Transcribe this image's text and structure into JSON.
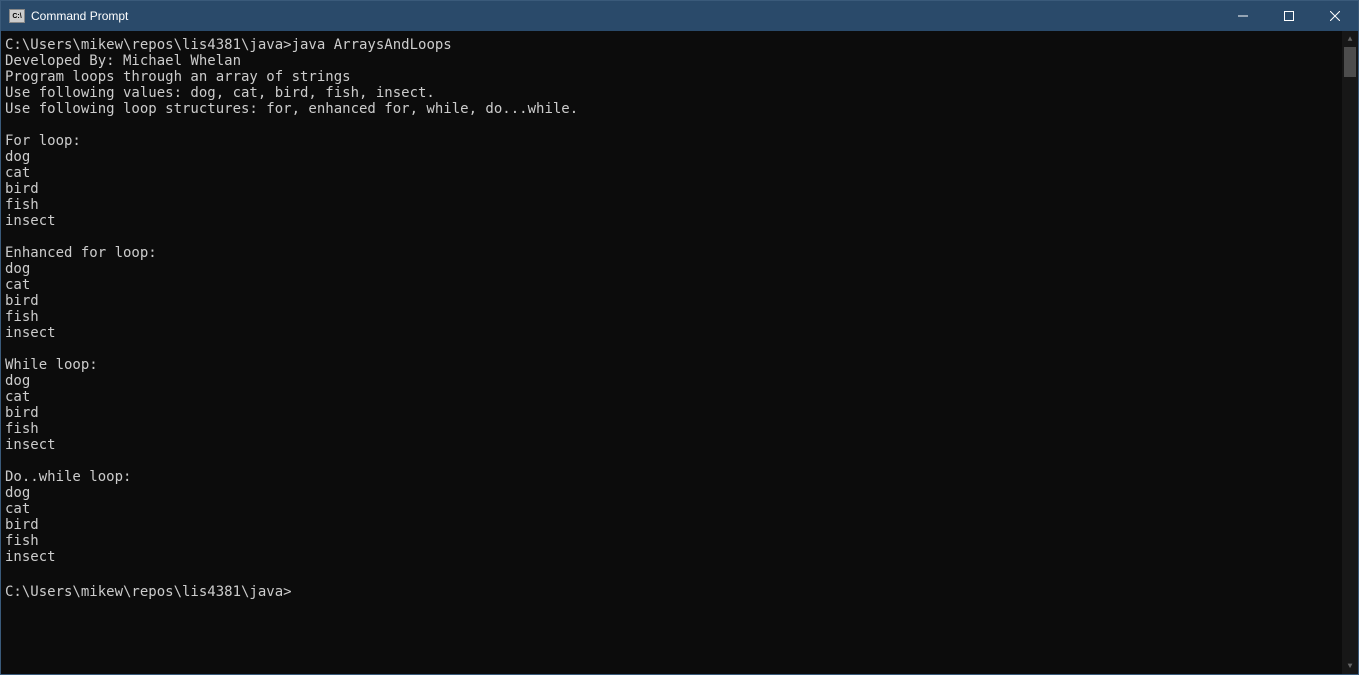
{
  "window": {
    "title": "Command Prompt"
  },
  "terminal": {
    "prompt1": "C:\\Users\\mikew\\repos\\lis4381\\java>",
    "command1": "java ArraysAndLoops",
    "output": {
      "line1": "Developed By: Michael Whelan",
      "line2": "Program loops through an array of strings",
      "line3": "Use following values: dog, cat, bird, fish, insect.",
      "line4": "Use following loop structures: for, enhanced for, while, do...while.",
      "section1_title": "For loop:",
      "section2_title": "Enhanced for loop:",
      "section3_title": "While loop:",
      "section4_title": "Do..while loop:",
      "items": {
        "i1": "dog",
        "i2": "cat",
        "i3": "bird",
        "i4": "fish",
        "i5": "insect"
      }
    },
    "prompt2": "C:\\Users\\mikew\\repos\\lis4381\\java>"
  }
}
